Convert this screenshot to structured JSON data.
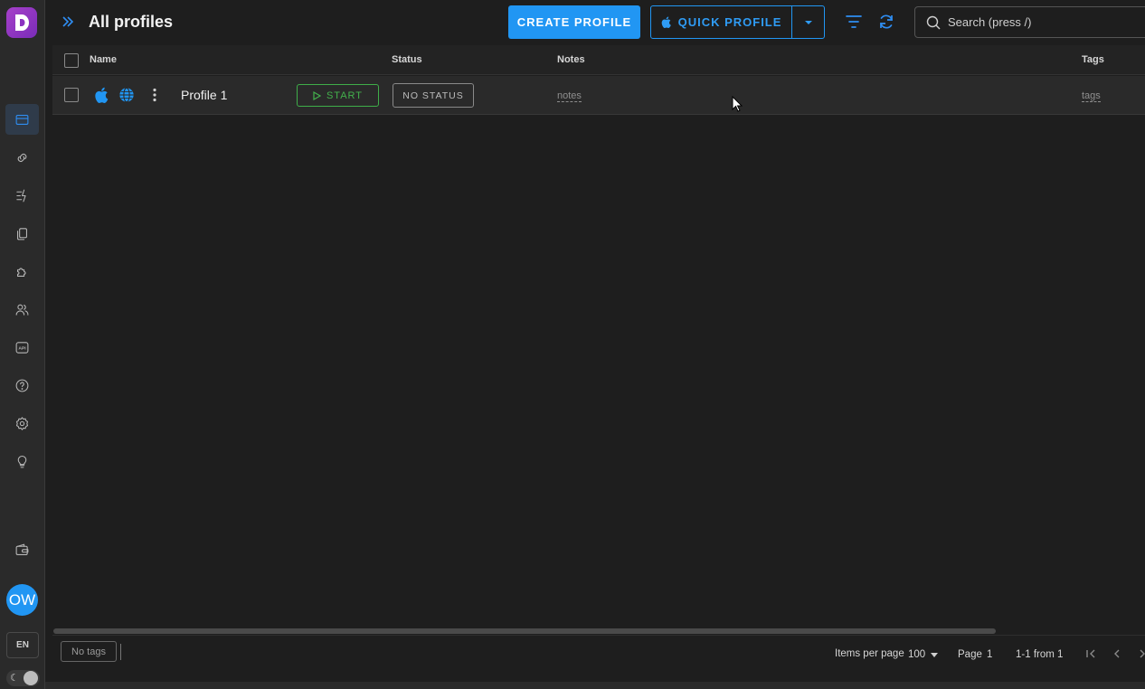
{
  "header": {
    "title": "All profiles",
    "create_label": "CREATE PROFILE",
    "quick_label": "QUICK PROFILE",
    "search_placeholder": "Search (press /)"
  },
  "table": {
    "columns": [
      "Name",
      "Status",
      "Notes",
      "Tags"
    ],
    "rows": [
      {
        "name": "Profile 1",
        "start_label": "START",
        "status_label": "NO STATUS",
        "notes": "notes",
        "tags": "tags"
      }
    ]
  },
  "footer": {
    "no_tags": "No tags",
    "items_per_page_label": "Items per page",
    "items_per_page_value": "100",
    "page_label": "Page",
    "page_value": "1",
    "range": "1-1 from 1"
  },
  "sidebar": {
    "avatar_initials": "OW",
    "language": "EN",
    "items": [
      "profiles-icon",
      "link-icon",
      "automation-icon",
      "copy-icon",
      "extension-icon",
      "team-icon",
      "api-icon",
      "help-icon",
      "settings-icon",
      "bulb-icon",
      "wallet-icon"
    ]
  },
  "colors": {
    "accent": "#2196f3",
    "start_green": "#43b14c",
    "brand": "#a640c9"
  }
}
